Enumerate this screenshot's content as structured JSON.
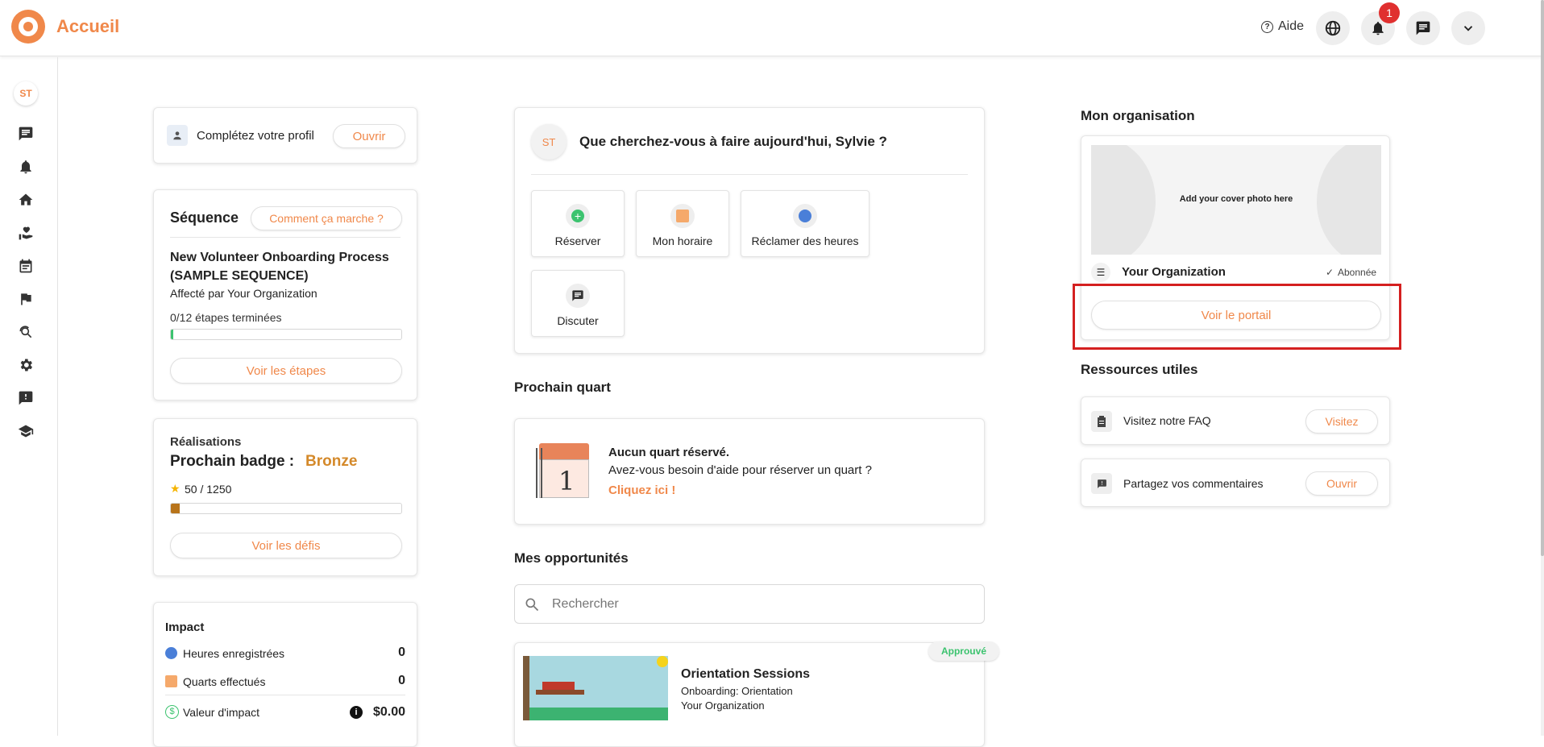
{
  "header": {
    "app_title": "Accueil",
    "help_label": "Aide",
    "notification_count": "1",
    "logo_icon": "target-logo-icon",
    "brand_color": "#f0884a"
  },
  "sidebar": {
    "avatar_initials": "ST",
    "items": [
      {
        "icon": "chat-icon"
      },
      {
        "icon": "bell-icon"
      },
      {
        "icon": "home-icon"
      },
      {
        "icon": "volunteer-hand-icon"
      },
      {
        "icon": "calendar-icon"
      },
      {
        "icon": "flag-icon"
      },
      {
        "icon": "search-refresh-icon"
      },
      {
        "icon": "gear-icon"
      },
      {
        "icon": "feedback-icon"
      },
      {
        "icon": "graduation-cap-icon"
      }
    ]
  },
  "profile_card": {
    "text": "Complétez votre profil",
    "button": "Ouvrir"
  },
  "sequence_card": {
    "title": "Séquence",
    "how_button": "Comment ça marche ?",
    "name_line1": "New Volunteer Onboarding Process",
    "name_line2": "(SAMPLE SEQUENCE)",
    "assigned": "Affecté par Your Organization",
    "progress_text": "0/12 étapes terminées",
    "progress_fraction": 0.01,
    "button": "Voir les étapes"
  },
  "achievements_card": {
    "title": "Réalisations",
    "next_badge_label": "Prochain badge :",
    "badge_name": "Bronze",
    "points_text": "50 / 1250",
    "progress_fraction": 0.04,
    "button": "Voir les défis"
  },
  "impact_card": {
    "title": "Impact",
    "rows": [
      {
        "label": "Heures enregistrées",
        "value": "0"
      },
      {
        "label": "Quarts effectués",
        "value": "0"
      },
      {
        "label": "Valeur d'impact",
        "value": "$0.00"
      }
    ]
  },
  "search_card": {
    "initials": "ST",
    "question": "Que cherchez-vous à faire aujourd'hui, Sylvie ?",
    "actions": [
      {
        "label": "Réserver"
      },
      {
        "label": "Mon horaire"
      },
      {
        "label": "Réclamer des heures"
      },
      {
        "label": "Discuter"
      }
    ]
  },
  "next_shift": {
    "title": "Prochain quart",
    "calendar_number": "1",
    "heading": "Aucun quart réservé.",
    "subtext": "Avez-vous besoin d'aide pour réserver un quart ?",
    "link": "Cliquez ici !"
  },
  "opportunities": {
    "title": "Mes opportunités",
    "search_placeholder": "Rechercher",
    "items": [
      {
        "status": "Approuvé",
        "title": "Orientation Sessions",
        "subtitle": "Onboarding: Orientation",
        "org": "Your Organization"
      }
    ]
  },
  "organization": {
    "title": "Mon organisation",
    "cover_text": "Add your cover photo here",
    "name": "Your Organization",
    "subscribed": "Abonnée",
    "portal_button": "Voir le portail"
  },
  "resources": {
    "title": "Ressources utiles",
    "items": [
      {
        "label": "Visitez notre FAQ",
        "button": "Visitez"
      },
      {
        "label": "Partagez vos commentaires",
        "button": "Ouvrir"
      }
    ]
  }
}
